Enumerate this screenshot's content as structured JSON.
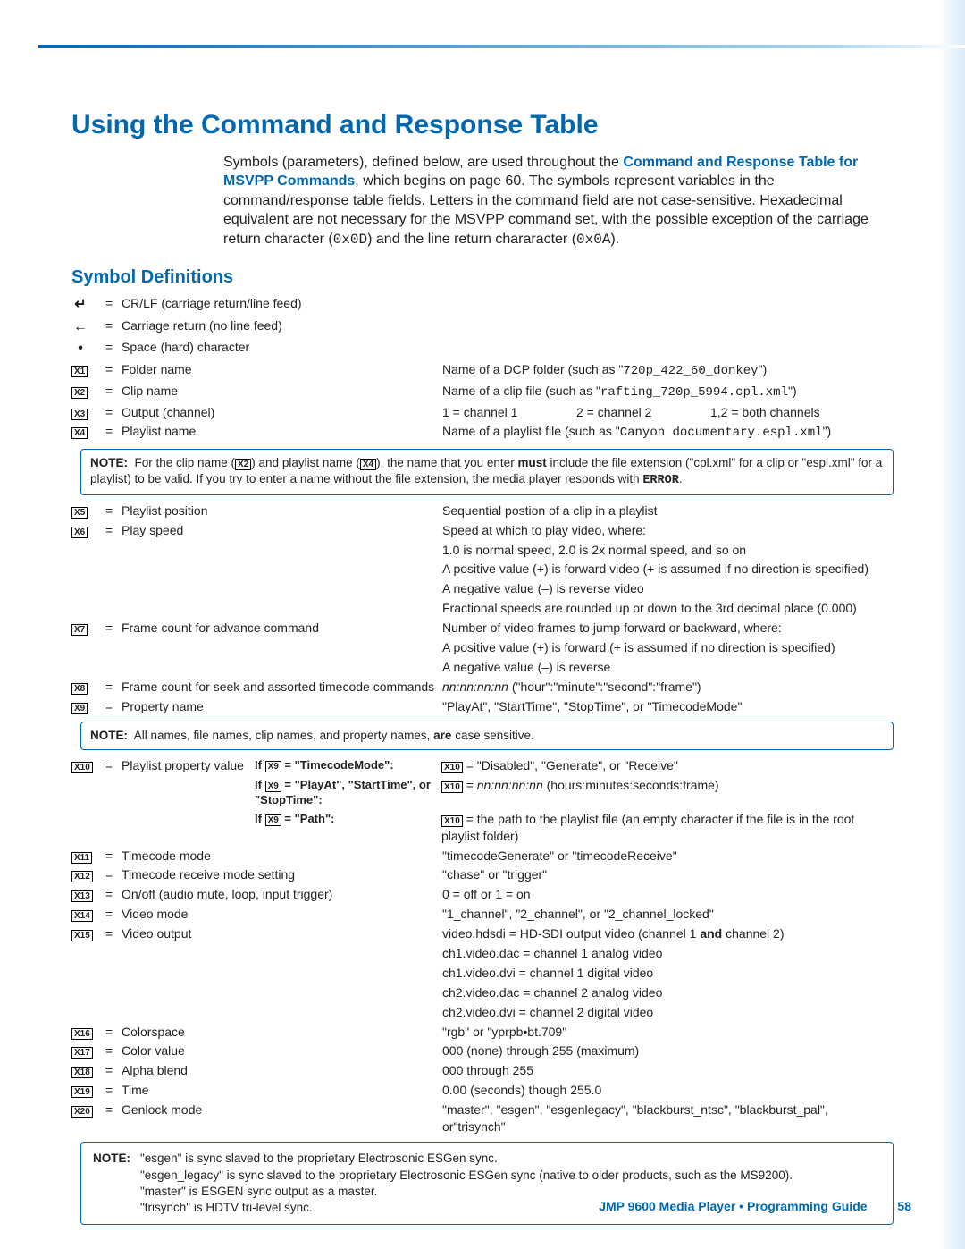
{
  "headings": {
    "h1": "Using the Command and Response Table",
    "h2": "Symbol Definitions"
  },
  "intro": {
    "p1a": "Symbols (parameters), defined below, are used throughout the ",
    "p1link": "Command and Response Table for MSVPP Commands",
    "p1b": ", which begins on page 60. The symbols represent variables in the command/response table fields. Letters in the command field are not case-sensitive. Hexadecimal equivalent are not necessary for the MSVPP command set, with the possible exception of the carriage return character (",
    "hex1": "0x0D",
    "p1c": ") and the line return chararacter (",
    "hex2": "0x0A",
    "p1d": ")."
  },
  "rows_top": [
    {
      "sym": "↵",
      "label": "CR/LF (carriage return/line feed)",
      "detail": ""
    },
    {
      "sym": "←",
      "label": "Carriage return (no line feed)",
      "detail": ""
    },
    {
      "sym": "•",
      "label": "Space (hard) character",
      "detail": ""
    }
  ],
  "rows_a": [
    {
      "sym": "X1",
      "label": "Folder name",
      "detail_a": "Name of a DCP folder (such as \"",
      "mono": "720p_422_60_donkey",
      "detail_b": "\")"
    },
    {
      "sym": "X2",
      "label": "Clip name",
      "detail_a": "Name of a clip file (such as \"",
      "mono": "rafting_720p_5994.cpl.xml",
      "detail_b": "\")"
    }
  ],
  "row_x3": {
    "sym": "X3",
    "label": "Output (channel)",
    "c1": "1 = channel 1",
    "c2": "2 = channel 2",
    "c3": "1,2 = both channels"
  },
  "row_x4": {
    "sym": "X4",
    "label": "Playlist name",
    "detail_a": "Name of a playlist file (such as \"",
    "mono": "Canyon documentary.espl.xml",
    "detail_b": "\")"
  },
  "note1a": "For the clip name (",
  "note1b": ") and playlist name (",
  "note1c": "), the name that you enter ",
  "note1must": "must",
  "note1d": " include the file extension (\"cpl.xml\" for a clip or \"espl.xml\" for a playlist) to be valid. If you try to enter a name without the file extension, the media player responds with ",
  "note1err": "ERROR",
  "note1e": ".",
  "rows_b": [
    {
      "sym": "X5",
      "label": "Playlist position",
      "detail": "Sequential postion of a clip in a playlist"
    },
    {
      "sym": "X6",
      "label": "Play speed",
      "detail": "Speed at which to play video, where:"
    }
  ],
  "x6_lines": [
    "1.0 is normal speed, 2.0 is 2x normal speed, and so on",
    "A positive value (+) is forward video (+ is assumed if no direction is specified)",
    "A negative value (–) is reverse video",
    "Fractional speeds are rounded up or down to the 3rd decimal place (0.000)"
  ],
  "rows_c": [
    {
      "sym": "X7",
      "label": "Frame count for advance command",
      "detail": "Number of video frames to jump forward or backward, where:"
    }
  ],
  "x7_lines": [
    "A positive value (+) is forward (+ is assumed if no direction is specified)",
    "A negative value (–) is reverse"
  ],
  "row_x8": {
    "sym": "X8",
    "label": "Frame count for seek and assorted timecode commands",
    "ital": "nn:nn:nn:nn",
    "detail": " (\"hour\":\"minute\":\"second\":\"frame\")"
  },
  "row_x9": {
    "sym": "X9",
    "label": "Property name",
    "detail": "\"PlayAt\", \"StartTime\", \"StopTime\", or \"TimecodeMode\""
  },
  "note2": "All names, file names, clip names, and property names, ",
  "note2b": "are",
  "note2c": " case sensitive.",
  "x10": {
    "sym": "X10",
    "label": "Playlist property value",
    "cond1_pre": "If ",
    "cond1_post": " = \"TimecodeMode\":",
    "cond2_pre": "If ",
    "cond2_post": " = \"PlayAt\", \"StartTime\", or \"StopTime\":",
    "cond3_pre": "If ",
    "cond3_post": " = \"Path\":",
    "ans1": " = \"Disabled\", \"Generate\", or \"Receive\"",
    "ans2_ital": "nn:nn:nn:nn",
    "ans2_post": " (hours:minutes:seconds:frame)",
    "ans3": " = the path to the playlist file (an empty character if the file is in the root playlist folder)"
  },
  "rows_d": [
    {
      "sym": "X11",
      "label": "Timecode mode",
      "detail": "\"timecodeGenerate\" or \"timecodeReceive\""
    },
    {
      "sym": "X12",
      "label": "Timecode receive mode setting",
      "detail": "\"chase\" or \"trigger\""
    },
    {
      "sym": "X13",
      "label": "On/off (audio mute, loop, input trigger)",
      "detail": "0 = off or 1 = on"
    },
    {
      "sym": "X14",
      "label": "Video mode",
      "detail": "\"1_channel\", \"2_channel\", or \"2_channel_locked\""
    }
  ],
  "row_x15": {
    "sym": "X15",
    "label": "Video output",
    "d1a": "video.hdsdi = HD-SDI output video (channel 1 ",
    "d1and": "and",
    "d1b": " channel 2)"
  },
  "x15_lines": [
    "ch1.video.dac = channel 1 analog video",
    "ch1.video.dvi = channel 1 digital video",
    "ch2.video.dac = channel 2 analog video",
    "ch2.video.dvi = channel 2 digital video"
  ],
  "rows_e": [
    {
      "sym": "X16",
      "label": "Colorspace",
      "detail": "\"rgb\" or \"yprpb•bt.709\""
    },
    {
      "sym": "X17",
      "label": "Color value",
      "detail": "000 (none) through 255 (maximum)"
    },
    {
      "sym": "X18",
      "label": "Alpha blend",
      "detail": "000 through 255"
    },
    {
      "sym": "X19",
      "label": "Time",
      "detail": "0.00 (seconds) though 255.0"
    },
    {
      "sym": "X20",
      "label": "Genlock mode",
      "detail": "\"master\", \"esgen\", \"esgenlegacy\", \"blackburst_ntsc\", \"blackburst_pal\", or\"trisynch\""
    }
  ],
  "note3": [
    "\"esgen\" is sync slaved to the proprietary Electrosonic ESGen sync.",
    "\"esgen_legacy\" is sync slaved to the proprietary Electrosonic ESGen sync (native to older products, such as the MS9200).",
    "\"master\" is ESGEN sync output as a master.",
    "\"trisynch\" is HDTV tri-level sync."
  ],
  "footer": {
    "title": "JMP 9600 Media Player • Programming Guide",
    "page": "58"
  },
  "labels": {
    "eq": "=",
    "note": "NOTE:",
    "x2": "X2",
    "x4": "X4",
    "x9": "X9",
    "x10": "X10",
    "eq2": " = "
  }
}
